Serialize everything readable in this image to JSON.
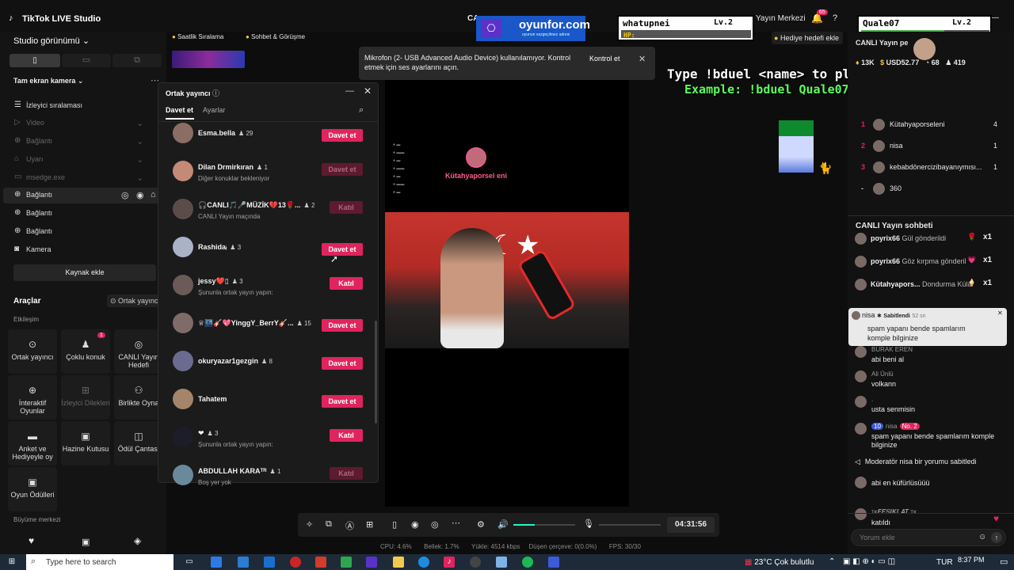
{
  "titlebar": {
    "app_title": "TikTok LIVE Studio",
    "ca_label": "CA",
    "yayin_merkezi": "Yayın Merkezi",
    "notif_count": "65",
    "hediye_hedefi": "Hediye hedefi ekle"
  },
  "left": {
    "studio_view": "Studio görünümü",
    "scene": "Tam ekran kamera",
    "sources": [
      {
        "label": "İzleyici sıralaması",
        "active": true,
        "icon": "list-icon"
      },
      {
        "label": "Video",
        "active": false,
        "icon": "play-icon"
      },
      {
        "label": "Bağlantı",
        "active": false,
        "icon": "globe-icon"
      },
      {
        "label": "Uyarı",
        "active": false,
        "icon": "bell-icon"
      },
      {
        "label": "msedge.exe",
        "active": false,
        "icon": "window-icon"
      },
      {
        "label": "Bağlantı",
        "active": true,
        "icon": "globe-icon"
      },
      {
        "label": "Bağlantı",
        "active": true,
        "icon": "globe-icon"
      },
      {
        "label": "Bağlantı",
        "active": true,
        "icon": "globe-icon"
      },
      {
        "label": "Kamera",
        "active": true,
        "icon": "camera-icon"
      }
    ],
    "add_source": "Kaynak ekle",
    "tools_title": "Araçlar",
    "ortak_yayinci_chip": "Ortak yayıncı",
    "etkilesim": "Etkileşim",
    "tools": [
      {
        "label": "Ortak yayıncı",
        "icon": "link-icon"
      },
      {
        "label": "Çoklu konuk",
        "icon": "users-icon",
        "badge": "1"
      },
      {
        "label": "CANLI Yayın Hedefi",
        "icon": "target-icon"
      },
      {
        "label": "İnteraktif Oyunlar",
        "icon": "gamepad-icon"
      },
      {
        "label": "İzleyici Dilekleri",
        "icon": "grid-icon"
      },
      {
        "label": "Birlikte Oyna",
        "icon": "controller-icon"
      },
      {
        "label": "Anket ve Hediyeyle oy",
        "icon": "poll-icon"
      },
      {
        "label": "Hazine Kutusu",
        "icon": "chest-icon"
      },
      {
        "label": "Ödül Çantası",
        "icon": "bag-icon"
      },
      {
        "label": "Oyun Ödülleri",
        "icon": "gift-icon"
      }
    ],
    "buyume": "Büyüme merkezi"
  },
  "topchips": {
    "saatlik": "Saatlik Sıralama",
    "sohbet": "Sohbet & Görüşme"
  },
  "ortak": {
    "title": "Ortak yayıncı",
    "tab_invite": "Davet et",
    "tab_settings": "Ayarlar",
    "rows": [
      {
        "name": "Esma.bella",
        "count": "29",
        "sub": "",
        "btn": "Davet et",
        "enabled": true
      },
      {
        "name": "Dilan Drmirkıran",
        "count": "1",
        "sub": "Diğer konuklar bekleniyor",
        "btn": "Davet et",
        "enabled": false
      },
      {
        "name": "🎧CANLI🎵🎤MÜZİK💔13🌹...",
        "count": "2",
        "sub": "CANLI Yayın maçında",
        "btn": "Katıl",
        "enabled": false
      },
      {
        "name": "Rashida⁠ᵢ",
        "count": "3",
        "sub": "",
        "btn": "Davet et",
        "enabled": true
      },
      {
        "name": "jessy❤️⁠▯",
        "count": "3",
        "sub": "Şununla ortak yayın yapın:",
        "btn": "Katıl",
        "enabled": true
      },
      {
        "name": "♕🌃🎸💖YinggY_BerrY🎸...",
        "count": "15",
        "sub": "",
        "btn": "Davet et",
        "enabled": true
      },
      {
        "name": "okuryazar1gezgin",
        "count": "8",
        "sub": "",
        "btn": "Davet et",
        "enabled": true
      },
      {
        "name": "Tahatem",
        "count": "",
        "sub": "",
        "btn": "Davet et",
        "enabled": true
      },
      {
        "name": "❤",
        "count": "3",
        "sub": "Şununla ortak yayın yapın:",
        "btn": "Katıl",
        "enabled": true
      },
      {
        "name": "ABDULLAH KARAᵀᴿ",
        "count": "1",
        "sub": "Boş yer yok",
        "btn": "Katıl",
        "enabled": false
      }
    ]
  },
  "notice": {
    "text": "Mikrofon (2- USB Advanced Audio Device) kullanılamıyor. Kontrol etmek için ses ayarlarını açın.",
    "button": "Kontrol et"
  },
  "overlay": {
    "brand": "oyunfor.com",
    "brand_sub": "oyunun vazgeçilmez adresi",
    "p1_name": "whatupnei",
    "p1_lv": "Lv.2",
    "hp": "HP:",
    "p2_name": "Quale07",
    "p2_lv": "Lv.2",
    "type_line": "Type !bduel <name> to play",
    "example_line": "Example: !bduel Quale07",
    "preview_user": "Kütahyaporsel eni"
  },
  "controls": {
    "timer": "04:31:56"
  },
  "stats": {
    "cpu": "CPU: 4.6%",
    "ram": "Bellek: 1.7%",
    "upload": "Yükle: 4514 kbps",
    "drop": "Düşen çerçeve: 0(0.0%)",
    "fps": "FPS: 30/30"
  },
  "right": {
    "header": "CANLI Yayın pe",
    "coins": "13K",
    "usd": "USD52.77",
    "viewers": "68",
    "likes": "419",
    "ranks": [
      {
        "pos": "1",
        "name": "Kütahyaporseleni",
        "val": "4"
      },
      {
        "pos": "2",
        "name": "nisa",
        "val": "1"
      },
      {
        "pos": "3",
        "name": "kebabdönercizibayanıymısı...",
        "val": "1"
      },
      {
        "pos": "-",
        "name": "360",
        "val": ""
      }
    ],
    "chat_title": "CANLI Yayın sohbeti",
    "gifts": [
      {
        "user": "poyrix66",
        "text": "Gül gönderildi",
        "count": "x1"
      },
      {
        "user": "poyrix66",
        "text": "Göz kırpma gönderil",
        "count": "x1"
      },
      {
        "user": "Kütahyapors...",
        "text": "Dondurma Külâ",
        "count": "x1"
      }
    ],
    "pinned": {
      "user": "nisa",
      "tag": "Sabitlendi",
      "time": "52 sn",
      "text": "spam yapanı bende spamlarım komple bilginize"
    },
    "messages": [
      {
        "user": "BURAK EREN",
        "text": "abi beni al"
      },
      {
        "user": "Ali Ünlü",
        "text": "volkann"
      },
      {
        "user": ".",
        "text": "usta senmisin"
      },
      {
        "user": "nisa",
        "text": "spam yapanı bende spamlarım komple bilginize",
        "badge": "10",
        "rank": "No. 2"
      },
      {
        "user": "",
        "text": "Moderatör nisa bir yorumu sabitledi"
      },
      {
        "user": "",
        "text": "abi en küfürlüsüüü"
      },
      {
        "user": "ᴛᴋ𝑭𝑬𝑺𝑰𝑲𝑳𝑨𝑻 ᴛᴋ",
        "text": "katıldı"
      }
    ],
    "comment_placeholder": "Yorum ekle"
  },
  "taskbar": {
    "search": "Type here to search",
    "weather": "23°C  Çok bulutlu",
    "lang": "TUR",
    "time": "8:37 PM"
  }
}
